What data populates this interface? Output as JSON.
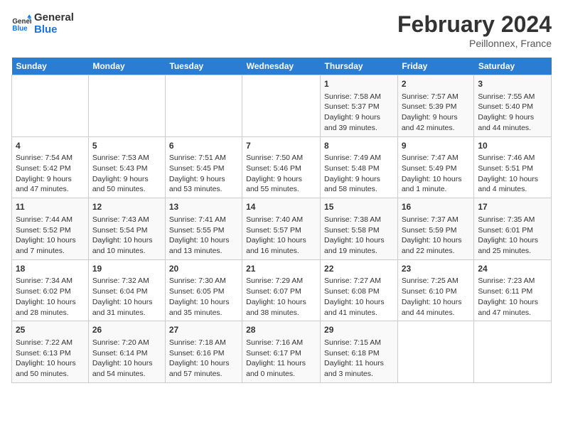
{
  "header": {
    "logo_line1": "General",
    "logo_line2": "Blue",
    "month": "February 2024",
    "location": "Peillonnex, France"
  },
  "days_of_week": [
    "Sunday",
    "Monday",
    "Tuesday",
    "Wednesday",
    "Thursday",
    "Friday",
    "Saturday"
  ],
  "weeks": [
    [
      {
        "day": "",
        "info": ""
      },
      {
        "day": "",
        "info": ""
      },
      {
        "day": "",
        "info": ""
      },
      {
        "day": "",
        "info": ""
      },
      {
        "day": "1",
        "info": "Sunrise: 7:58 AM\nSunset: 5:37 PM\nDaylight: 9 hours\nand 39 minutes."
      },
      {
        "day": "2",
        "info": "Sunrise: 7:57 AM\nSunset: 5:39 PM\nDaylight: 9 hours\nand 42 minutes."
      },
      {
        "day": "3",
        "info": "Sunrise: 7:55 AM\nSunset: 5:40 PM\nDaylight: 9 hours\nand 44 minutes."
      }
    ],
    [
      {
        "day": "4",
        "info": "Sunrise: 7:54 AM\nSunset: 5:42 PM\nDaylight: 9 hours\nand 47 minutes."
      },
      {
        "day": "5",
        "info": "Sunrise: 7:53 AM\nSunset: 5:43 PM\nDaylight: 9 hours\nand 50 minutes."
      },
      {
        "day": "6",
        "info": "Sunrise: 7:51 AM\nSunset: 5:45 PM\nDaylight: 9 hours\nand 53 minutes."
      },
      {
        "day": "7",
        "info": "Sunrise: 7:50 AM\nSunset: 5:46 PM\nDaylight: 9 hours\nand 55 minutes."
      },
      {
        "day": "8",
        "info": "Sunrise: 7:49 AM\nSunset: 5:48 PM\nDaylight: 9 hours\nand 58 minutes."
      },
      {
        "day": "9",
        "info": "Sunrise: 7:47 AM\nSunset: 5:49 PM\nDaylight: 10 hours\nand 1 minute."
      },
      {
        "day": "10",
        "info": "Sunrise: 7:46 AM\nSunset: 5:51 PM\nDaylight: 10 hours\nand 4 minutes."
      }
    ],
    [
      {
        "day": "11",
        "info": "Sunrise: 7:44 AM\nSunset: 5:52 PM\nDaylight: 10 hours\nand 7 minutes."
      },
      {
        "day": "12",
        "info": "Sunrise: 7:43 AM\nSunset: 5:54 PM\nDaylight: 10 hours\nand 10 minutes."
      },
      {
        "day": "13",
        "info": "Sunrise: 7:41 AM\nSunset: 5:55 PM\nDaylight: 10 hours\nand 13 minutes."
      },
      {
        "day": "14",
        "info": "Sunrise: 7:40 AM\nSunset: 5:57 PM\nDaylight: 10 hours\nand 16 minutes."
      },
      {
        "day": "15",
        "info": "Sunrise: 7:38 AM\nSunset: 5:58 PM\nDaylight: 10 hours\nand 19 minutes."
      },
      {
        "day": "16",
        "info": "Sunrise: 7:37 AM\nSunset: 5:59 PM\nDaylight: 10 hours\nand 22 minutes."
      },
      {
        "day": "17",
        "info": "Sunrise: 7:35 AM\nSunset: 6:01 PM\nDaylight: 10 hours\nand 25 minutes."
      }
    ],
    [
      {
        "day": "18",
        "info": "Sunrise: 7:34 AM\nSunset: 6:02 PM\nDaylight: 10 hours\nand 28 minutes."
      },
      {
        "day": "19",
        "info": "Sunrise: 7:32 AM\nSunset: 6:04 PM\nDaylight: 10 hours\nand 31 minutes."
      },
      {
        "day": "20",
        "info": "Sunrise: 7:30 AM\nSunset: 6:05 PM\nDaylight: 10 hours\nand 35 minutes."
      },
      {
        "day": "21",
        "info": "Sunrise: 7:29 AM\nSunset: 6:07 PM\nDaylight: 10 hours\nand 38 minutes."
      },
      {
        "day": "22",
        "info": "Sunrise: 7:27 AM\nSunset: 6:08 PM\nDaylight: 10 hours\nand 41 minutes."
      },
      {
        "day": "23",
        "info": "Sunrise: 7:25 AM\nSunset: 6:10 PM\nDaylight: 10 hours\nand 44 minutes."
      },
      {
        "day": "24",
        "info": "Sunrise: 7:23 AM\nSunset: 6:11 PM\nDaylight: 10 hours\nand 47 minutes."
      }
    ],
    [
      {
        "day": "25",
        "info": "Sunrise: 7:22 AM\nSunset: 6:13 PM\nDaylight: 10 hours\nand 50 minutes."
      },
      {
        "day": "26",
        "info": "Sunrise: 7:20 AM\nSunset: 6:14 PM\nDaylight: 10 hours\nand 54 minutes."
      },
      {
        "day": "27",
        "info": "Sunrise: 7:18 AM\nSunset: 6:16 PM\nDaylight: 10 hours\nand 57 minutes."
      },
      {
        "day": "28",
        "info": "Sunrise: 7:16 AM\nSunset: 6:17 PM\nDaylight: 11 hours\nand 0 minutes."
      },
      {
        "day": "29",
        "info": "Sunrise: 7:15 AM\nSunset: 6:18 PM\nDaylight: 11 hours\nand 3 minutes."
      },
      {
        "day": "",
        "info": ""
      },
      {
        "day": "",
        "info": ""
      }
    ]
  ]
}
